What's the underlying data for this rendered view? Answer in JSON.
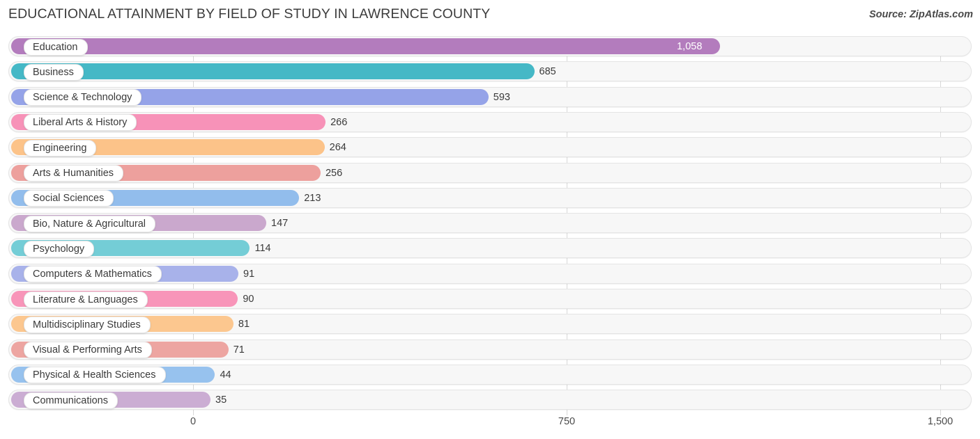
{
  "header": {
    "title": "EDUCATIONAL ATTAINMENT BY FIELD OF STUDY IN LAWRENCE COUNTY",
    "source": "Source: ZipAtlas.com"
  },
  "axis": {
    "ticks": [
      "0",
      "750",
      "1,500"
    ]
  },
  "chart_data": {
    "type": "bar",
    "orientation": "horizontal",
    "title": "EDUCATIONAL ATTAINMENT BY FIELD OF STUDY IN LAWRENCE COUNTY",
    "subtitle": "Source: ZipAtlas.com",
    "xlabel": "",
    "ylabel": "",
    "xlim": [
      0,
      1500
    ],
    "xticks": [
      0,
      750,
      1500
    ],
    "xtick_labels": [
      "0",
      "750",
      "1,500"
    ],
    "grid": true,
    "legend": false,
    "categories": [
      "Education",
      "Business",
      "Science & Technology",
      "Liberal Arts & History",
      "Engineering",
      "Arts & Humanities",
      "Social Sciences",
      "Bio, Nature & Agricultural",
      "Psychology",
      "Computers & Mathematics",
      "Literature & Languages",
      "Multidisciplinary Studies",
      "Visual & Performing Arts",
      "Physical & Health Sciences",
      "Communications"
    ],
    "values": [
      1058,
      685,
      593,
      266,
      264,
      256,
      213,
      147,
      114,
      91,
      90,
      81,
      71,
      44,
      35
    ],
    "value_labels": [
      "1,058",
      "685",
      "593",
      "266",
      "264",
      "256",
      "213",
      "147",
      "114",
      "91",
      "90",
      "81",
      "71",
      "44",
      "35"
    ],
    "colors": [
      "#b37cbd",
      "#45b8c6",
      "#95a3e8",
      "#f792b8",
      "#fcc389",
      "#eda09d",
      "#92bdec",
      "#caa8cd",
      "#74cdd6",
      "#a8b2ea",
      "#f895b9",
      "#fcc78f",
      "#eda5a1",
      "#97c2ee",
      "#cbadd3"
    ]
  }
}
